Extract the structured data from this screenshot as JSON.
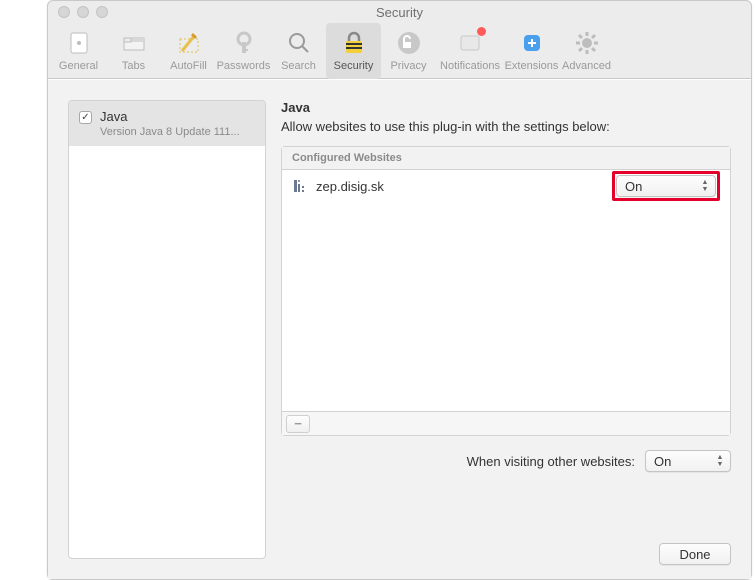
{
  "window": {
    "title": "Security"
  },
  "toolbar": {
    "items": [
      {
        "label": "General"
      },
      {
        "label": "Tabs"
      },
      {
        "label": "AutoFill"
      },
      {
        "label": "Passwords"
      },
      {
        "label": "Search"
      },
      {
        "label": "Security"
      },
      {
        "label": "Privacy"
      },
      {
        "label": "Notifications"
      },
      {
        "label": "Extensions"
      },
      {
        "label": "Advanced"
      }
    ]
  },
  "sidebar": {
    "items": [
      {
        "checked": true,
        "name": "Java",
        "version": "Version Java 8 Update 111..."
      }
    ]
  },
  "main": {
    "heading": "Java",
    "description": "Allow websites to use this plug-in with the settings below:",
    "table_header": "Configured Websites",
    "rows": [
      {
        "site": "zep.disig.sk",
        "value": "On"
      }
    ],
    "footer_label": "When visiting other websites:",
    "footer_value": "On"
  },
  "buttons": {
    "done": "Done"
  }
}
